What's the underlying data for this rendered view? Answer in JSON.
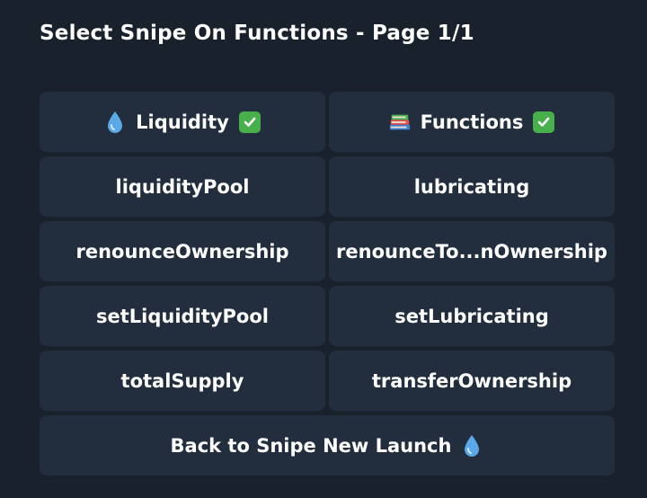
{
  "header": {
    "title": "Select Snipe On Functions - Page 1/1"
  },
  "buttons": {
    "liquidity_label": "Liquidity",
    "functions_label": "Functions",
    "liquidity_pool": "liquidityPool",
    "lubricating": "lubricating",
    "renounce_ownership": "renounceOwnership",
    "renounce_to_ownership": "renounceTo...nOwnership",
    "set_liquidity_pool": "setLiquidityPool",
    "set_lubricating": "setLubricating",
    "total_supply": "totalSupply",
    "transfer_ownership": "transferOwnership",
    "back_label": "Back to Snipe New Launch"
  },
  "icons": {
    "liquidity": "droplet-icon",
    "functions": "books-icon",
    "selected": "check-mark-icon",
    "back": "droplet-icon"
  },
  "colors": {
    "background": "#18212c",
    "button": "#222e3d",
    "text": "#ffffff",
    "check": "#47b04b",
    "droplet": "#5aa8e8"
  }
}
